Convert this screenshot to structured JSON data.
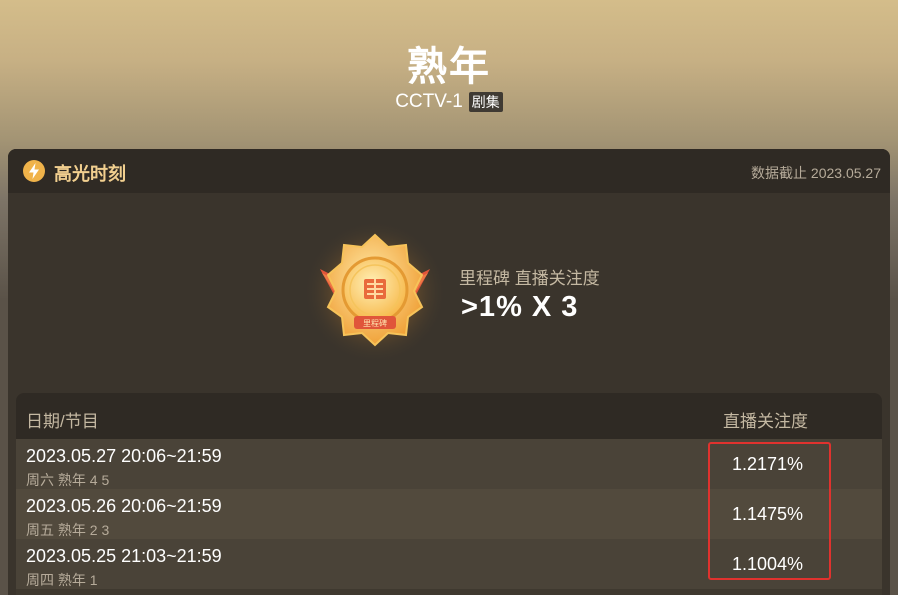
{
  "header": {
    "title": "熟年",
    "channel": "CCTV-1",
    "tag": "剧集"
  },
  "card": {
    "label": "高光时刻",
    "date_text": "数据截止 2023.05.27",
    "icon": "lightning-icon",
    "milestone": {
      "label": "里程碑 直播关注度",
      "value": ">1% X 3",
      "medal_text": "里程碑"
    }
  },
  "table": {
    "headers": {
      "left": "日期/节目",
      "right": "直播关注度"
    },
    "rows": [
      {
        "datetime": "2023.05.27 20:06~21:59",
        "sub": "周六 熟年 4 5",
        "value": "1.2171%"
      },
      {
        "datetime": "2023.05.26 20:06~21:59",
        "sub": "周五 熟年 2 3",
        "value": "1.1475%"
      },
      {
        "datetime": "2023.05.25 21:03~21:59",
        "sub": "周四 熟年 1",
        "value": "1.1004%"
      }
    ]
  },
  "colors": {
    "accent_gold": "#f1cf8f",
    "highlight_box": "#e0322e"
  }
}
